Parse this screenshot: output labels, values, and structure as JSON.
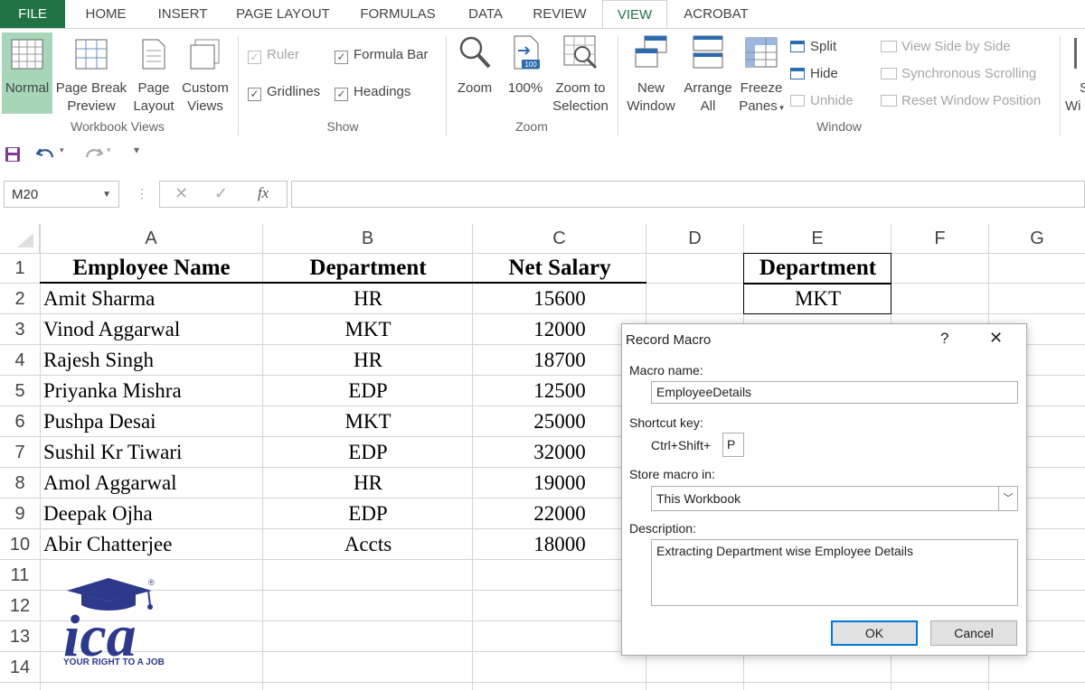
{
  "tabs": [
    "FILE",
    "HOME",
    "INSERT",
    "PAGE LAYOUT",
    "FORMULAS",
    "DATA",
    "REVIEW",
    "VIEW",
    "ACROBAT"
  ],
  "ribbon": {
    "workbook_views": {
      "normal": "Normal",
      "page_break_1": "Page Break",
      "page_break_2": "Preview",
      "page_layout_1": "Page",
      "page_layout_2": "Layout",
      "custom_views_1": "Custom",
      "custom_views_2": "Views",
      "label": "Workbook Views"
    },
    "show": {
      "ruler": "Ruler",
      "formula_bar": "Formula Bar",
      "gridlines": "Gridlines",
      "headings": "Headings",
      "label": "Show"
    },
    "zoom": {
      "zoom": "Zoom",
      "zoom100": "100%",
      "zoom100_icon": "100",
      "zoom_sel_1": "Zoom to",
      "zoom_sel_2": "Selection",
      "label": "Zoom"
    },
    "window": {
      "new_window_1": "New",
      "new_window_2": "Window",
      "arrange_1": "Arrange",
      "arrange_2": "All",
      "freeze_1": "Freeze",
      "freeze_2": "Panes",
      "split": "Split",
      "hide": "Hide",
      "unhide": "Unhide",
      "side_by_side": "View Side by Side",
      "sync_scroll": "Synchronous Scrolling",
      "reset_pos": "Reset Window Position",
      "cut_1": "S",
      "cut_2": "Wi",
      "label": "Window"
    }
  },
  "namebox": "M20",
  "fx": "fx",
  "columns": [
    "A",
    "B",
    "C",
    "D",
    "E",
    "F",
    "G"
  ],
  "rows": [
    "1",
    "2",
    "3",
    "4",
    "5",
    "6",
    "7",
    "8",
    "9",
    "10",
    "11",
    "12",
    "13",
    "14"
  ],
  "table": {
    "headers": [
      "Employee Name",
      "Department",
      "Net Salary"
    ],
    "rows": [
      [
        "Amit Sharma",
        "HR",
        "15600"
      ],
      [
        "Vinod Aggarwal",
        "MKT",
        "12000"
      ],
      [
        "Rajesh Singh",
        "HR",
        "18700"
      ],
      [
        "Priyanka Mishra",
        "EDP",
        "12500"
      ],
      [
        "Pushpa Desai",
        "MKT",
        "25000"
      ],
      [
        "Sushil Kr Tiwari",
        "EDP",
        "32000"
      ],
      [
        "Amol Aggarwal",
        "HR",
        "19000"
      ],
      [
        "Deepak Ojha",
        "EDP",
        "22000"
      ],
      [
        "Abir Chatterjee",
        "Accts",
        "18000"
      ]
    ]
  },
  "criteria": {
    "header": "Department",
    "value": "MKT"
  },
  "dialog": {
    "title": "Record Macro",
    "help": "?",
    "close": "✕",
    "macro_name_label": "Macro name:",
    "macro_name": "EmployeeDetails",
    "shortcut_label": "Shortcut key:",
    "shortcut_prefix": "Ctrl+Shift+",
    "shortcut_key": "P",
    "store_label": "Store macro in:",
    "store_value": "This Workbook",
    "desc_label": "Description:",
    "description": "Extracting Department wise Employee Details",
    "ok": "OK",
    "cancel": "Cancel"
  },
  "logo": {
    "text": "ica",
    "tagline": "YOUR RIGHT TO A JOB",
    "reg": "®"
  },
  "colors": {
    "accent": "#217346",
    "logo_blue": "#2d3a8c"
  }
}
